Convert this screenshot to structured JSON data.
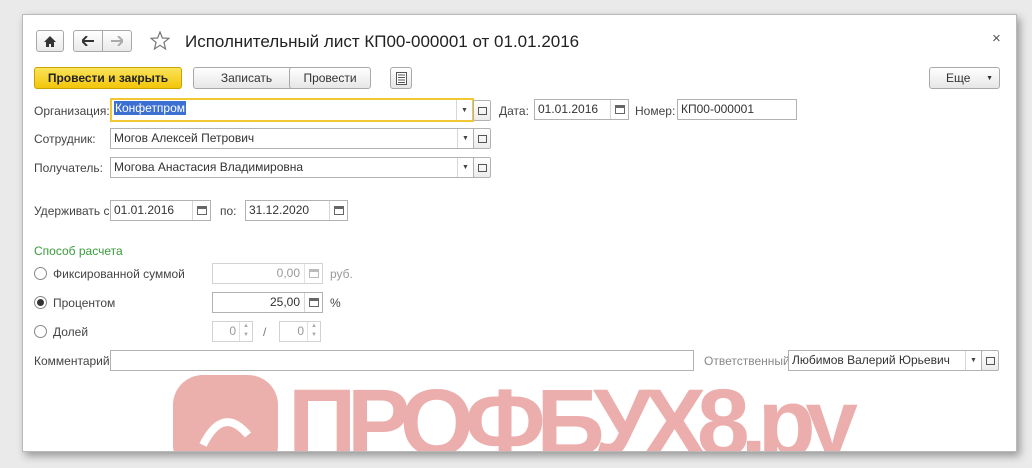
{
  "window": {
    "title": "Исполнительный лист КП00-000001 от 01.01.2016",
    "close_glyph": "×"
  },
  "toolbar": {
    "post_close_label": "Провести и закрыть",
    "save_label": "Записать",
    "post_label": "Провести",
    "more_label": "Еще"
  },
  "form": {
    "organization_label": "Организация:",
    "organization_value": "Конфетпром",
    "date_label": "Дата:",
    "date_value": "01.01.2016",
    "number_label": "Номер:",
    "number_value": "КП00-000001",
    "employee_label": "Сотрудник:",
    "employee_value": "Могов Алексей Петрович",
    "recipient_label": "Получатель:",
    "recipient_value": "Могова Анастасия Владимировна",
    "withhold_from_label": "Удерживать с:",
    "withhold_from_value": "01.01.2016",
    "withhold_to_label": "по:",
    "withhold_to_value": "31.12.2020",
    "calc_group_label": "Способ расчета",
    "fixed_label": "Фиксированной суммой",
    "fixed_value": "0,00",
    "fixed_unit": "руб.",
    "percent_label": "Процентом",
    "percent_value": "25,00",
    "percent_unit": "%",
    "share_label": "Долей",
    "share_num": "0",
    "share_sep": "/",
    "share_den": "0",
    "comment_label": "Комментарий:",
    "comment_value": "",
    "responsible_label": "Ответственный:",
    "responsible_value": "Любимов Валерий Юрьевич",
    "calc_method_selected": "percent"
  },
  "watermark": {
    "text": "ПРОФБУХ8.ру",
    "color": "#d9534f"
  }
}
